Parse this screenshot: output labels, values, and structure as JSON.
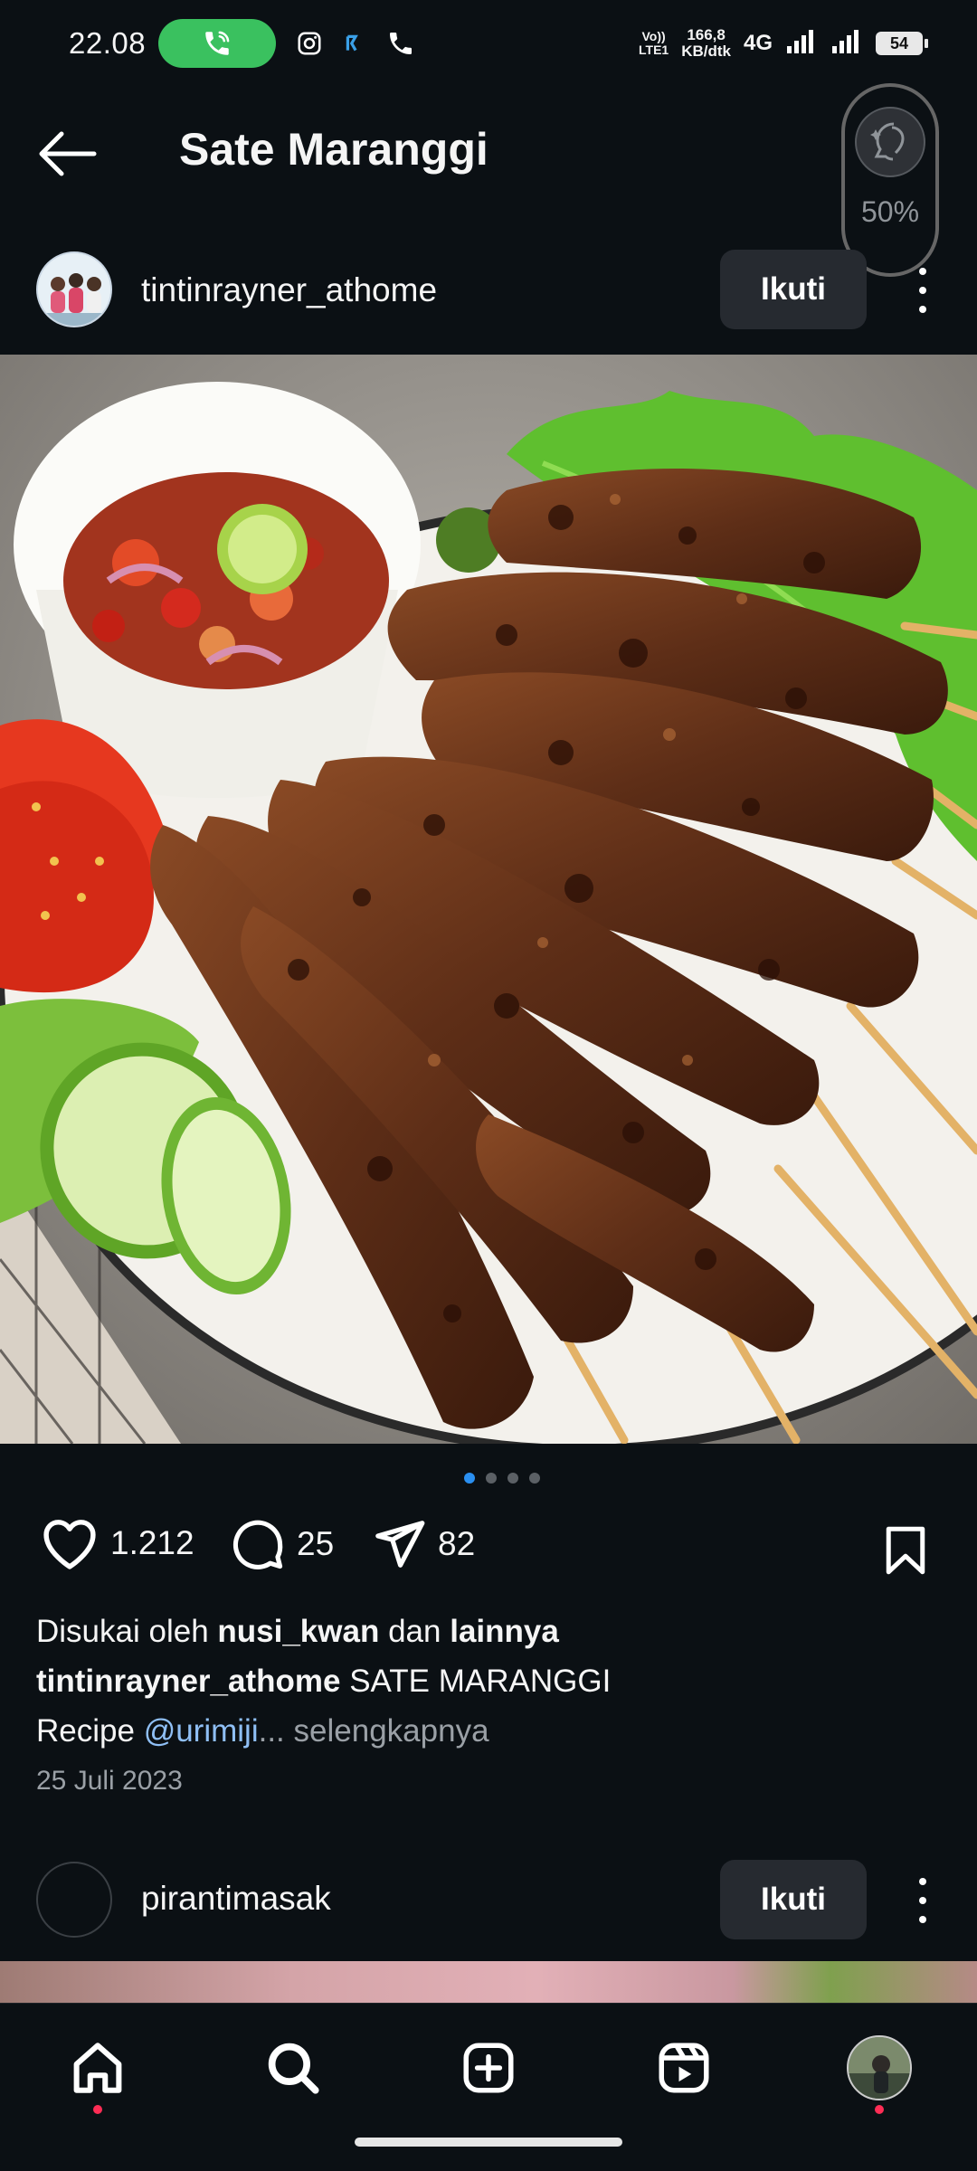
{
  "status_bar": {
    "time": "22.08",
    "volte_label_top": "Vo))",
    "volte_label_bottom": "LTE1",
    "net_speed_value": "166,8",
    "net_speed_unit": "KB/dtk",
    "network_type": "4G",
    "battery": "54"
  },
  "header": {
    "title": "Sate Maranggi",
    "widget_percent": "50%"
  },
  "post": {
    "username": "tintinrayner_athome",
    "follow_label": "Ikuti",
    "carousel": {
      "count": 4,
      "active_index": 0
    },
    "likes": "1.212",
    "comments": "25",
    "shares": "82",
    "liked_by_prefix": "Disukai oleh",
    "liked_by_user": "nusi_kwan",
    "liked_by_joiner": "dan",
    "liked_by_suffix": "lainnya",
    "caption_user": "tintinrayner_athome",
    "caption_text": "SATE MARANGGI",
    "caption_line2_text": "Recipe",
    "caption_mention": "@urimiji",
    "caption_ellipsis": "...",
    "caption_more": "selengkapnya",
    "date": "25 Juli 2023"
  },
  "next_post": {
    "username": "pirantimasak",
    "follow_label": "Ikuti"
  },
  "bottom_nav": {
    "items": [
      "home-icon",
      "search-icon",
      "create-icon",
      "reels-icon",
      "profile-avatar"
    ]
  },
  "colors": {
    "background": "#0b1014",
    "call_pill": "#3ac15f",
    "button_bg": "#262a30",
    "mention": "#8fbff5",
    "active_dot": "#2a8ff0",
    "notification_dot": "#ff2d55"
  }
}
